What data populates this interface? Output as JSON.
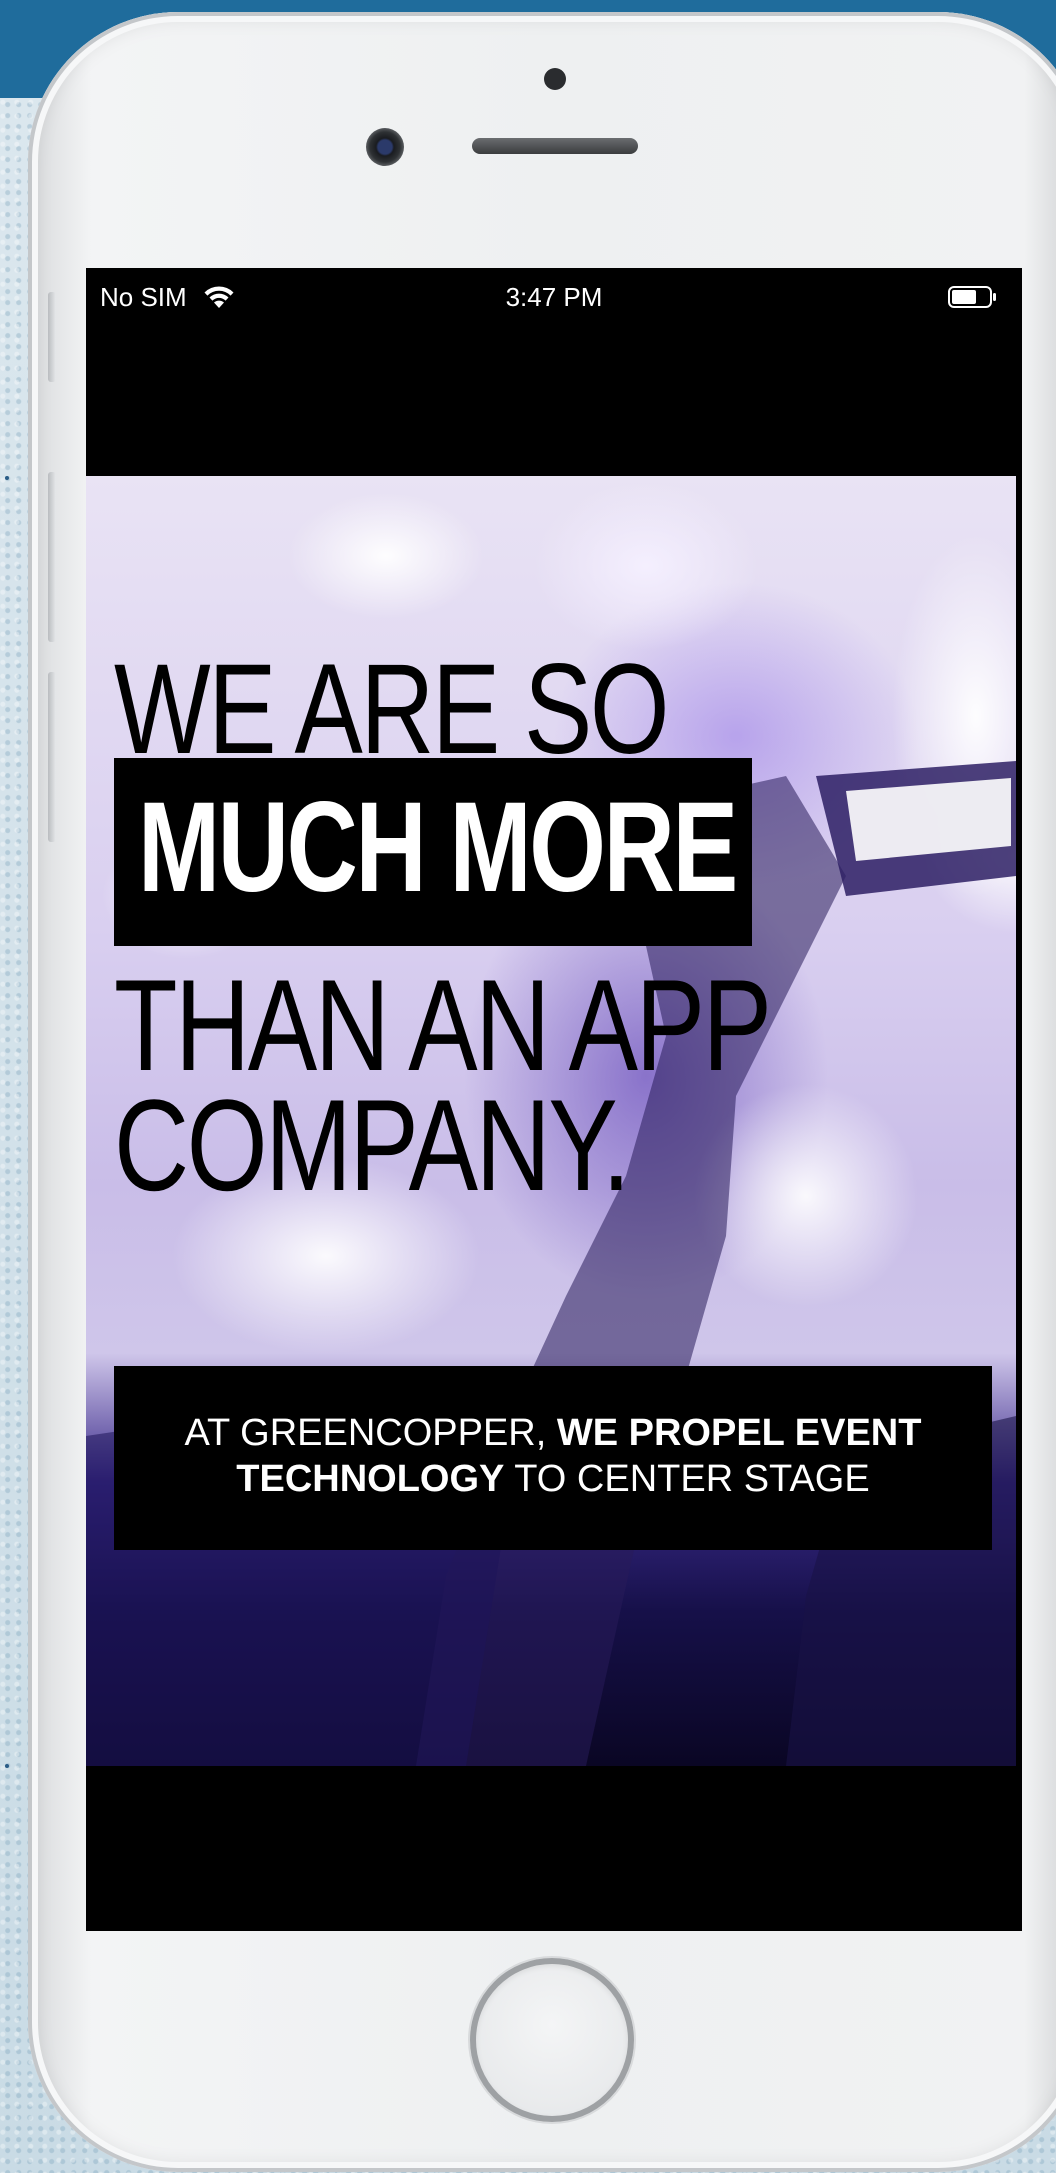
{
  "status_bar": {
    "carrier": "No SIM",
    "time": "3:47 PM",
    "wifi_icon": "wifi-icon",
    "battery_icon": "battery-icon"
  },
  "hero": {
    "line1": "WE ARE SO",
    "line2": "MUCH MORE",
    "line3": "THAN AN APP",
    "line4": "COMPANY."
  },
  "caption": {
    "part1": "AT GREENCOPPER, ",
    "part2_bold": "WE PROPEL EVENT",
    "part3_bold": "TECHNOLOGY",
    "part4": " TO CENTER STAGE"
  },
  "colors": {
    "backdrop_top": "#1f6c9c",
    "screen_bg": "#000000",
    "text_on_dark": "#ffffff"
  }
}
